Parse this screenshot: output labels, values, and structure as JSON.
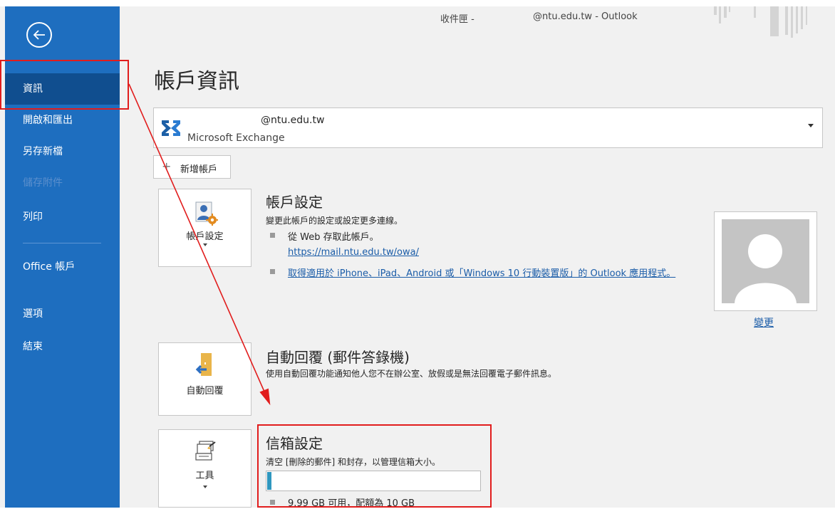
{
  "titlebar": {
    "folder": "收件匣 -",
    "account_app": "@ntu.edu.tw  -  Outlook"
  },
  "sidebar": {
    "items": [
      {
        "label": "資訊"
      },
      {
        "label": "開啟和匯出"
      },
      {
        "label": "另存新檔"
      },
      {
        "label": "儲存附件"
      },
      {
        "label": "列印"
      },
      {
        "label": "Office 帳戶"
      },
      {
        "label": "選項"
      },
      {
        "label": "結束"
      }
    ]
  },
  "page": {
    "title": "帳戶資訊"
  },
  "account": {
    "email": "@ntu.edu.tw",
    "type": "Microsoft Exchange"
  },
  "add_account": {
    "label": "新增帳戶"
  },
  "account_settings": {
    "button_label": "帳戶設定",
    "title": "帳戶設定",
    "description": "變更此帳戶的設定或設定更多連線。",
    "bullet1": "從 Web 存取此帳戶。",
    "owa_link": "https://mail.ntu.edu.tw/owa/",
    "mobile_link": "取得適用於 iPhone、iPad、Android 或「Windows 10 行動裝置版」的 Outlook 應用程式。",
    "change_photo": "變更"
  },
  "auto_reply": {
    "button_label": "自動回覆",
    "title": "自動回覆 (郵件答錄機)",
    "description": "使用自動回覆功能通知他人您不在辦公室、放假或是無法回覆電子郵件訊息。"
  },
  "mailbox": {
    "button_label": "工具",
    "title": "信箱設定",
    "description": "清空 [刪除的郵件] 和封存，以管理信箱大小。",
    "usage_fraction": 0.001,
    "quota_text": "9.99 GB 可用，配額為 10 GB"
  },
  "colors": {
    "sidebar": "#1e6ebf",
    "sidebar_active": "#104e8f",
    "accent_annotation": "#e11d1d",
    "progress": "#2f97bf"
  }
}
